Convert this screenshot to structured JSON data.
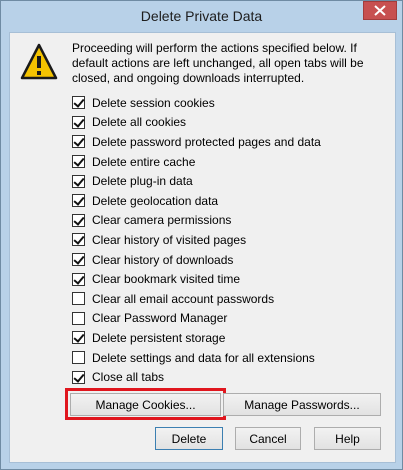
{
  "dialog": {
    "title": "Delete Private Data",
    "intro": "Proceeding will perform the actions specified below. If default actions are left unchanged, all open tabs will be closed, and ongoing downloads interrupted."
  },
  "options": [
    {
      "label": "Delete session cookies",
      "checked": true
    },
    {
      "label": "Delete all cookies",
      "checked": true
    },
    {
      "label": "Delete password protected pages and data",
      "checked": true
    },
    {
      "label": "Delete entire cache",
      "checked": true
    },
    {
      "label": "Delete plug-in data",
      "checked": true
    },
    {
      "label": "Delete geolocation data",
      "checked": true
    },
    {
      "label": "Clear camera permissions",
      "checked": true
    },
    {
      "label": "Clear history of visited pages",
      "checked": true
    },
    {
      "label": "Clear history of downloads",
      "checked": true
    },
    {
      "label": "Clear bookmark visited time",
      "checked": true
    },
    {
      "label": "Clear all email account passwords",
      "checked": false
    },
    {
      "label": "Clear Password Manager",
      "checked": false
    },
    {
      "label": "Delete persistent storage",
      "checked": true
    },
    {
      "label": "Delete settings and data for all extensions",
      "checked": false
    },
    {
      "label": "Close all tabs",
      "checked": true
    }
  ],
  "buttons": {
    "manage_cookies": "Manage Cookies...",
    "manage_passwords": "Manage Passwords...",
    "delete": "Delete",
    "cancel": "Cancel",
    "help": "Help"
  },
  "colors": {
    "highlight": "#e0161e",
    "close_button": "#c75050"
  }
}
